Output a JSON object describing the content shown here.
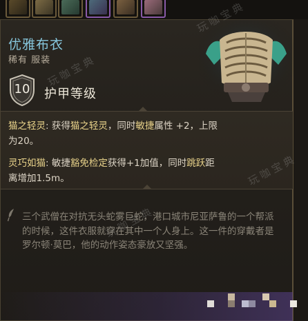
{
  "item": {
    "name": "优雅布衣",
    "rarity_type": "稀有 服装"
  },
  "armor": {
    "value": "10",
    "label": "护甲等级"
  },
  "properties": [
    {
      "name": "猫之轻灵",
      "sep": ": ",
      "text_a": "获得",
      "link": "猫之轻灵",
      "text_b": "，同时",
      "link2": "敏捷",
      "text_c": "属性 +2，上限",
      "line2": "为20。"
    },
    {
      "name": "灵巧如猫",
      "sep": ": ",
      "text_a": "敏捷",
      "link": "豁免检定",
      "text_b": "获得+1加值，同时",
      "link2": "跳跃",
      "text_c": "距",
      "line2": "离增加1.5m。"
    }
  ],
  "lore": "三个武僧在对抗无头蛇雾巨蛇，港口城市尼亚萨鲁的一个帮派的时候，这件衣服就穿在其中一个人身上。这一件的穿戴者是罗尔顿·莫巴，他的动作姿态豪放又坚强。",
  "watermarks": [
    "玩咖宝典",
    "玩咖宝典",
    "玩咖宝典",
    "玩咖宝典"
  ],
  "colors": {
    "item_name": "#86c6dc",
    "property_highlight": "#e8d28a",
    "lore_text": "#8a8478",
    "rarity_accent": "#5a428c"
  },
  "icons": {
    "armor": "shield-icon",
    "lore": "quill-icon",
    "art": "robe-chest-armor-icon"
  }
}
